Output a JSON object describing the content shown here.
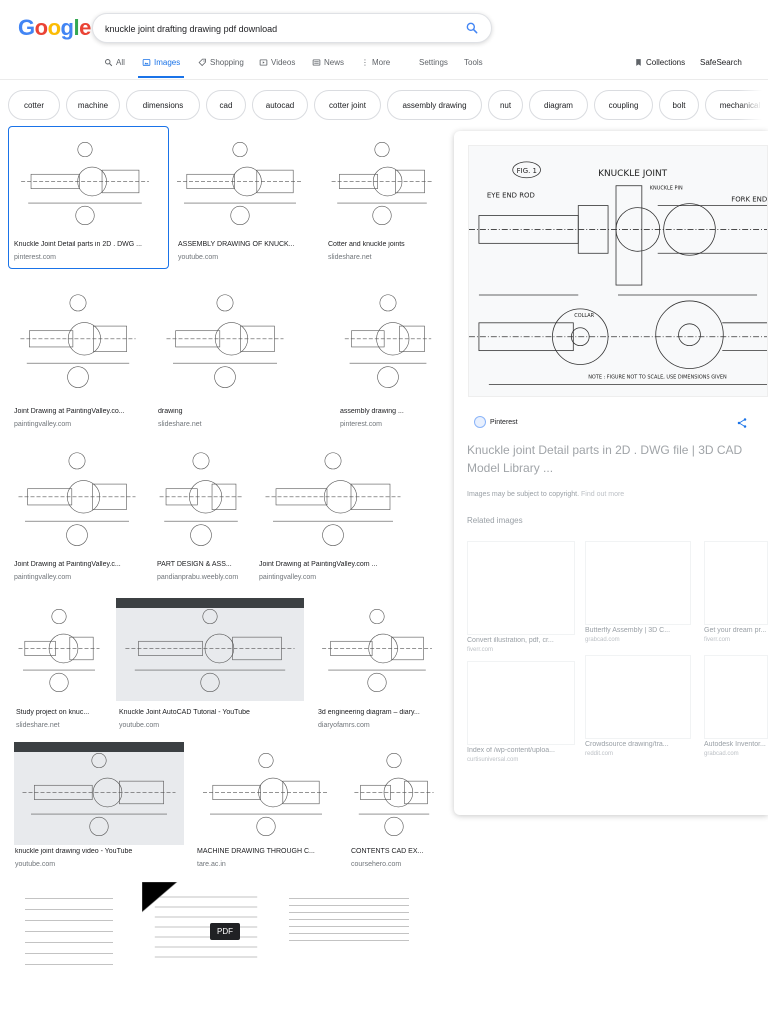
{
  "logo": {
    "text": "Google",
    "colors": [
      "#4285F4",
      "#EA4335",
      "#FBBC05",
      "#4285F4",
      "#34A853",
      "#EA4335"
    ]
  },
  "search": {
    "value": "knuckle joint drafting drawing pdf download",
    "placeholder": ""
  },
  "tabs": [
    {
      "label": "All",
      "icon": "search-icon"
    },
    {
      "label": "Images",
      "icon": "image-icon",
      "active": true
    },
    {
      "label": "Shopping",
      "icon": "tag-icon"
    },
    {
      "label": "Videos",
      "icon": "video-icon"
    },
    {
      "label": "News",
      "icon": "news-icon"
    },
    {
      "label": "More",
      "icon": "more-icon"
    },
    {
      "label": "Settings"
    },
    {
      "label": "Tools"
    },
    {
      "label": "Collections",
      "icon": "bookmark-icon"
    },
    {
      "label": "SafeSearch"
    }
  ],
  "chips": [
    "cotter",
    "machine",
    "dimensions",
    "cad",
    "autocad",
    "cotter joint",
    "assembly drawing",
    "nut",
    "diagram",
    "coupling",
    "bolt",
    "mechanical"
  ],
  "results": [
    {
      "title": "Knuckle Joint Detail parts in 2D . DWG ...",
      "source": "pinterest.com"
    },
    {
      "title": "ASSEMBLY DRAWING OF KNUCK...",
      "source": "youtube.com"
    },
    {
      "title": "Cotter and knuckle joints",
      "source": "slideshare.net"
    },
    {
      "title": "Joint Drawing at PaintingValley.co...",
      "source": "paintingvalley.com"
    },
    {
      "title": "drawing",
      "source": "slideshare.net"
    },
    {
      "title": "assembly drawing ...",
      "source": "pinterest.com"
    },
    {
      "title": "Joint Drawing at PaintingValley.c...",
      "source": "paintingvalley.com"
    },
    {
      "title": "PART DESIGN & ASS...",
      "source": "pandianprabu.weebly.com"
    },
    {
      "title": "Joint Drawing at PaintingValley.com ...",
      "source": "paintingvalley.com"
    },
    {
      "title": "Study project on knuc...",
      "source": "slideshare.net"
    },
    {
      "title": "Knuckle Joint AutoCAD Tutorial - YouTube",
      "source": "youtube.com"
    },
    {
      "title": "3d engineering diagram – diary...",
      "source": "diaryofamrs.com"
    },
    {
      "title": "knuckle joint drawing video - YouTube",
      "source": "youtube.com"
    },
    {
      "title": "MACHINE DRAWING THROUGH C...",
      "source": "tare.ac.in"
    },
    {
      "title": "CONTENTS CAD EX...",
      "source": "coursehero.com"
    }
  ],
  "pdf_badge": "PDF",
  "panel": {
    "source": "Pinterest",
    "title": "Knuckle joint Detail parts in 2D . DWG file | 3D CAD Model Library ...",
    "copyright": "Images may be subject to copyright.",
    "find_out_more": "Find out more",
    "related_heading": "Related images",
    "drawing_labels": {
      "fig": "FIG. 1",
      "heading": "KNUCKLE JOINT",
      "eye": "EYE END ROD",
      "pin": "KNUCKLE PIN",
      "fork": "FORK END",
      "collar": "COLLAR",
      "note": "NOTE : FIGURE NOT TO SCALE, USE DIMENSIONS GIVEN"
    },
    "related": [
      {
        "title": "Convert illustration, pdf, cr...",
        "source": "fiverr.com"
      },
      {
        "title": "Butterfly Assembly | 3D C...",
        "source": "grabcad.com"
      },
      {
        "title": "Get your dream pr...",
        "source": "fiverr.com"
      },
      {
        "title": "Index of /wp-content/uploa...",
        "source": "curtisuniversal.com"
      },
      {
        "title": "Crowdsource drawing/tra...",
        "source": "reddit.com"
      },
      {
        "title": "Autodesk Inventor...",
        "source": "grabcad.com"
      }
    ]
  }
}
